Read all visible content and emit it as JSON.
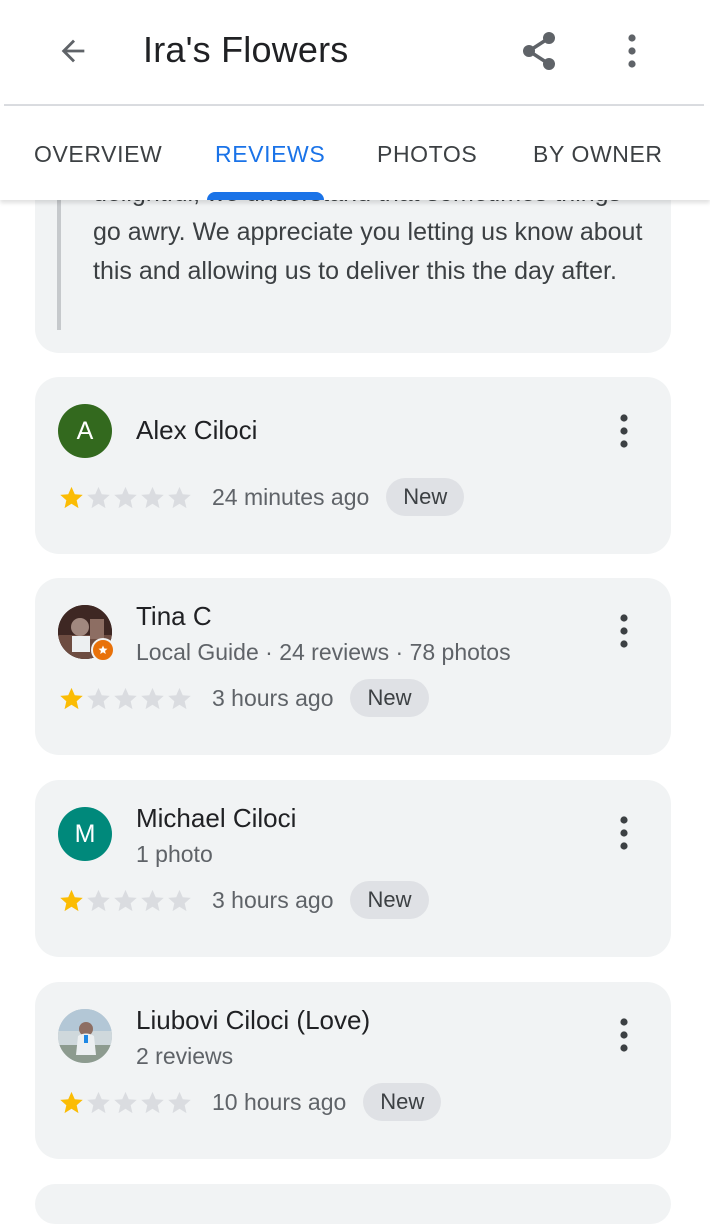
{
  "app_bar": {
    "title": "Ira's Flowers",
    "back_icon": "arrow-back-icon",
    "share_icon": "share-icon",
    "more_icon": "more-vert-icon"
  },
  "tabs": [
    {
      "label": "OVERVIEW",
      "active": false
    },
    {
      "label": "REVIEWS",
      "active": true
    },
    {
      "label": "PHOTOS",
      "active": false
    },
    {
      "label": "BY OWNER",
      "active": false
    }
  ],
  "owner_reply": {
    "text": "delightful, we understand that sometimes things go awry. We appreciate you letting us know about this and allowing us to deliver this the day after."
  },
  "reviews": [
    {
      "author": "Alex Ciloci",
      "details": "",
      "rating": 1,
      "max_rating": 5,
      "time": "24 minutes ago",
      "badge": "New",
      "avatar_letter": "A",
      "avatar_color": "#33691e"
    },
    {
      "author": "Tina C",
      "details": "Local Guide · 24 reviews · 78 photos",
      "rating": 1,
      "max_rating": 5,
      "time": "3 hours ago",
      "badge": "New",
      "avatar_letter": "",
      "avatar_color": "#5d4037"
    },
    {
      "author": "Michael Ciloci",
      "details": "1 photo",
      "rating": 1,
      "max_rating": 5,
      "time": "3 hours ago",
      "badge": "New",
      "avatar_letter": "M",
      "avatar_color": "#00897b"
    },
    {
      "author": "Liubovi Ciloci (Love)",
      "details": "2 reviews",
      "rating": 1,
      "max_rating": 5,
      "time": "10 hours ago",
      "badge": "New",
      "avatar_letter": "",
      "avatar_color": "#90a4ae"
    }
  ],
  "colors": {
    "accent": "#1a73e8",
    "star_filled": "#fbbc04",
    "star_empty": "#dadce0",
    "card_bg": "#f1f3f4",
    "badge_bg": "#dfe1e5"
  }
}
